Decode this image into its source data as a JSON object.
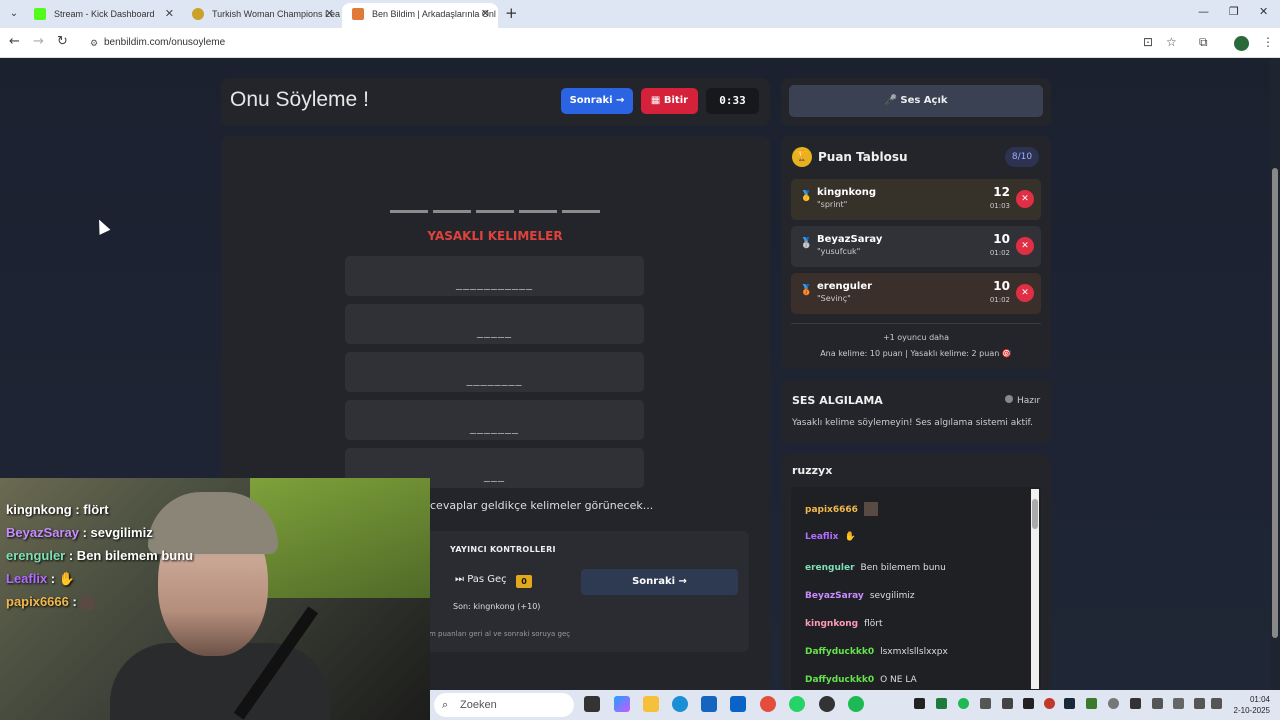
{
  "browser": {
    "tabs": [
      {
        "title": "Stream - Kick Dashboard",
        "color": "#53fc18"
      },
      {
        "title": "Turkish Woman Champions Lea",
        "color": "#c9a227"
      },
      {
        "title": "Ben Bildim | Arkadaşlarınla Onl",
        "color": "#e07a3a"
      }
    ],
    "url": "benbildim.com/onusoyleme"
  },
  "game": {
    "title": "Onu Söyleme !",
    "next_label": "Sonraki →",
    "finish_label": "Bitir",
    "timer": "0:33",
    "forbidden_title": "YASAKLI KELIMELER",
    "forbidden": [
      "___________",
      "_____",
      "________",
      "_______",
      "___"
    ],
    "hint": "cevaplar geldikçe kelimeler görünecek...",
    "controls": {
      "header": "YAYINCI KONTROLLERI",
      "pass_label": "Pas Geç",
      "pass_count": "0",
      "next_label": "Sonraki →",
      "last": "Son: kingnkong (+10)",
      "desc": "m puanları geri al ve sonraki soruya geç"
    }
  },
  "sound_button": "Ses Açık",
  "leaderboard": {
    "title": "Puan Tablosu",
    "count": "8/10",
    "rows": [
      {
        "name": "kingnkong",
        "word": "\"sprint\"",
        "points": "12",
        "time": "01:03",
        "medal": "🥇"
      },
      {
        "name": "BeyazSaray",
        "word": "\"yusufcuk\"",
        "points": "10",
        "time": "01:02",
        "medal": "🥈"
      },
      {
        "name": "erenguler",
        "word": "\"Sevinç\"",
        "points": "10",
        "time": "01:02",
        "medal": "🥉"
      }
    ],
    "more": "+1 oyuncu daha",
    "scoring": "Ana kelime: 10 puan | Yasaklı kelime: 2 puan 🎯"
  },
  "voice": {
    "title": "SES ALGILAMA",
    "status": "Hazır",
    "desc": "Yasaklı kelime söylemeyin! Ses algılama sistemi aktif."
  },
  "chat": {
    "channel": "ruzzyx",
    "messages": [
      {
        "user": "papix6666",
        "text": "",
        "color": "#f2b84b"
      },
      {
        "user": "Leaflix",
        "text": "",
        "color": "#b26cff"
      },
      {
        "user": "erenguler",
        "text": "Ben bilemem bunu",
        "color": "#7fe0b6"
      },
      {
        "user": "BeyazSaray",
        "text": "sevgilimiz",
        "color": "#c98cff"
      },
      {
        "user": "kingnkong",
        "text": "flört",
        "color": "#ff9ab5"
      },
      {
        "user": "Daffyduckkk0",
        "text": "lsxmxlsllslxxpx",
        "color": "#64e34c"
      },
      {
        "user": "Daffyduckkk0",
        "text": "O NE LA",
        "color": "#64e34c"
      }
    ]
  },
  "overlay_chat": [
    {
      "user": "kingnkong",
      "text": " : flört",
      "color": "#ffffff"
    },
    {
      "user": "BeyazSaray",
      "text": " : sevgilimiz",
      "color": "#c98cff"
    },
    {
      "user": "erenguler",
      "text": " : Ben bilemem bunu",
      "color": "#7fe0b6"
    },
    {
      "user": "Leaflix",
      "text": " :",
      "color": "#b26cff"
    },
    {
      "user": "papix6666",
      "text": " :",
      "color": "#f2b84b"
    }
  ],
  "taskbar": {
    "search_placeholder": "Zoeken",
    "time": "01:04",
    "date": "2-10-2025"
  }
}
